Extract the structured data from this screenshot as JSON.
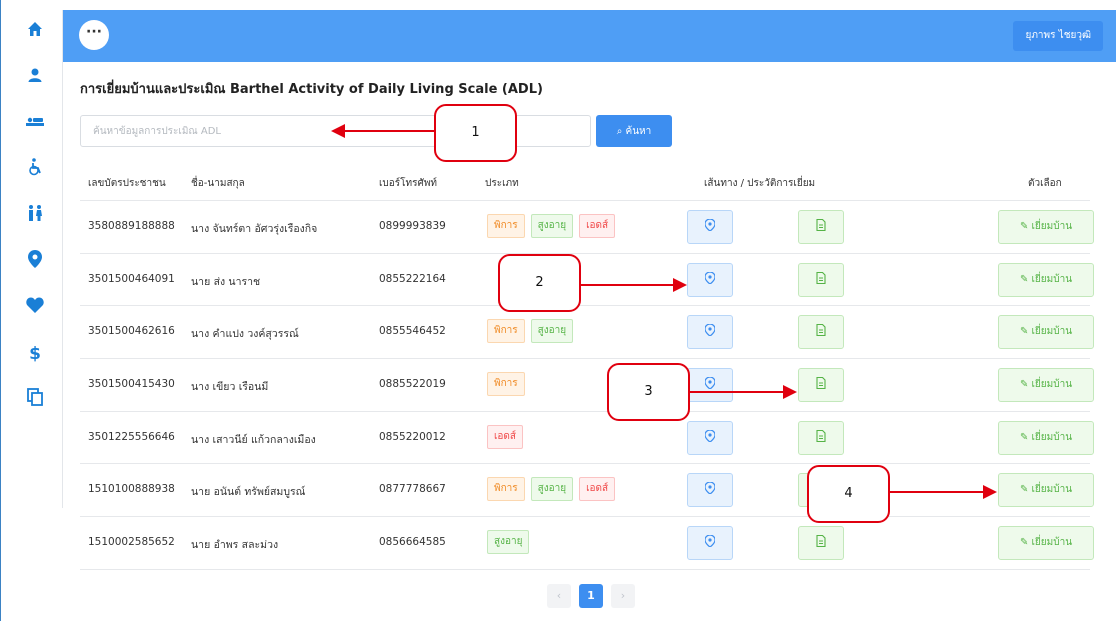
{
  "sidebar": {
    "icons": [
      "home-icon",
      "user-icon",
      "bed-icon",
      "wheelchair-icon",
      "elderly-couple-icon",
      "map-pin-icon",
      "heart-icon",
      "dollar-icon",
      "copy-icon"
    ]
  },
  "topbar": {
    "menu_label": "···",
    "user_name": "ยุภาพร ไชยวุฒิ"
  },
  "page": {
    "title": "การเยี่ยมบ้านและประเมิณ Barthel Activity of Daily Living Scale (ADL)"
  },
  "search": {
    "placeholder": "ค้นหาข้อมูลการประเมิณ ADL",
    "button_label": "ค้นหา"
  },
  "table": {
    "headers": {
      "id": "เลขบัตรประชาชน",
      "name": "ชื่อ-นามสกุล",
      "phone": "เบอร์โทรศัพท์",
      "type": "ประเภท",
      "history": "เส้นทาง / ประวัติการเยี่ยม",
      "options": "ตัวเลือก"
    },
    "visit_label": "เยี่ยมบ้าน",
    "rows": [
      {
        "id": "3580889188888",
        "name": "นาง จันทร์ตา อัศวรุ่งเรืองกิจ",
        "phone": "0899993839",
        "tags": [
          "พิการ",
          "สูงอายุ",
          "เอดส์"
        ]
      },
      {
        "id": "3501500464091",
        "name": "นาย ส่ง นาราช",
        "phone": "0855222164",
        "tags": []
      },
      {
        "id": "3501500462616",
        "name": "นาง คำแปง วงค์สุวรรณ์",
        "phone": "0855546452",
        "tags": [
          "พิการ",
          "สูงอายุ"
        ]
      },
      {
        "id": "3501500415430",
        "name": "นาง เขียว เรือนมี",
        "phone": "0885522019",
        "tags": [
          "พิการ"
        ]
      },
      {
        "id": "3501225556646",
        "name": "นาง เสาวนีย์ แก้วกลางเมือง",
        "phone": "0855220012",
        "tags": [
          "เอดส์"
        ]
      },
      {
        "id": "1510100888938",
        "name": "นาย อนันต์ ทรัพย์สมบูรณ์",
        "phone": "0877778667",
        "tags": [
          "พิการ",
          "สูงอายุ",
          "เอดส์"
        ]
      },
      {
        "id": "1510002585652",
        "name": "นาย อำพร สละม่วง",
        "phone": "0856664585",
        "tags": [
          "สูงอายุ"
        ]
      }
    ]
  },
  "tag_colors": {
    "พิการ": "tag-disabled",
    "สูงอายุ": "tag-elder",
    "เอดส์": "tag-aids"
  },
  "pagination": {
    "prev": "‹",
    "current": "1",
    "next": "›"
  },
  "callouts": [
    "1",
    "2",
    "3",
    "4"
  ]
}
